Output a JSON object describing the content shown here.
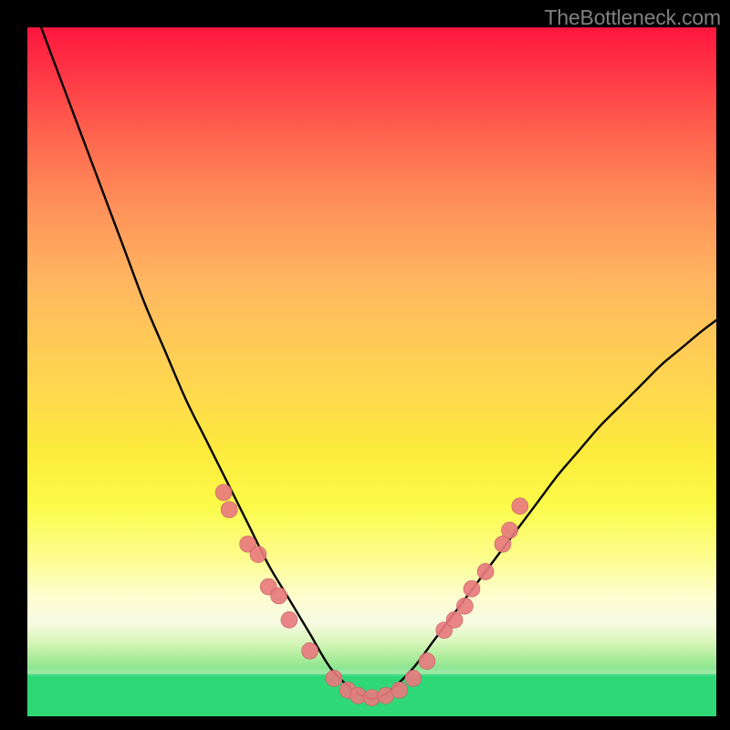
{
  "watermark": "TheBottleneck.com",
  "colors": {
    "background": "#000000",
    "curve": "#000000",
    "marker_fill": "#e77b7e",
    "marker_stroke": "#c65f63",
    "green": "#2fd876"
  },
  "chart_data": {
    "type": "line",
    "title": "",
    "xlabel": "",
    "ylabel": "",
    "xlim": [
      0,
      100
    ],
    "ylim": [
      0,
      100
    ],
    "series": [
      {
        "name": "bottleneck-curve",
        "x": [
          2,
          5,
          8,
          11,
          14,
          17,
          20,
          23,
          26,
          29,
          32,
          35,
          38,
          41,
          44,
          47,
          48.5,
          50,
          51.5,
          53,
          56,
          59,
          62,
          65,
          68,
          71,
          74,
          77,
          80,
          83,
          86,
          89,
          92,
          95,
          98,
          100
        ],
        "y": [
          100,
          92,
          84,
          76,
          68,
          60,
          53,
          46,
          40,
          34,
          28,
          22,
          17,
          12,
          7,
          4,
          3,
          2.5,
          3,
          4,
          7,
          11,
          15,
          19,
          23,
          27,
          31,
          35,
          38.5,
          42,
          45,
          48,
          51,
          53.5,
          56,
          57.5
        ]
      }
    ],
    "markers": [
      {
        "name": "left-cluster-top-a",
        "x": 28.5,
        "y": 32.5
      },
      {
        "name": "left-cluster-top-b",
        "x": 29.3,
        "y": 30.0
      },
      {
        "name": "left-cluster-mid-a",
        "x": 32.0,
        "y": 25.0
      },
      {
        "name": "left-cluster-mid-b",
        "x": 33.5,
        "y": 23.5
      },
      {
        "name": "left-cluster-mid-c",
        "x": 35.0,
        "y": 18.8
      },
      {
        "name": "left-cluster-low-a",
        "x": 36.5,
        "y": 17.5
      },
      {
        "name": "left-cluster-low-b",
        "x": 38.0,
        "y": 14.0
      },
      {
        "name": "left-near-bottom",
        "x": 41.0,
        "y": 9.5
      },
      {
        "name": "bottom-left-a",
        "x": 44.5,
        "y": 5.5
      },
      {
        "name": "bottom-left-b",
        "x": 46.5,
        "y": 3.8
      },
      {
        "name": "bottom-min-a",
        "x": 48.0,
        "y": 3.0
      },
      {
        "name": "bottom-min-b",
        "x": 50.0,
        "y": 2.7
      },
      {
        "name": "bottom-min-c",
        "x": 52.0,
        "y": 3.0
      },
      {
        "name": "bottom-right-a",
        "x": 54.0,
        "y": 3.8
      },
      {
        "name": "bottom-right-b",
        "x": 56.0,
        "y": 5.5
      },
      {
        "name": "right-near-bottom",
        "x": 58.0,
        "y": 8.0
      },
      {
        "name": "right-cluster-low-a",
        "x": 60.5,
        "y": 12.5
      },
      {
        "name": "right-cluster-low-b",
        "x": 62.0,
        "y": 14.0
      },
      {
        "name": "right-cluster-mid-a",
        "x": 63.5,
        "y": 16.0
      },
      {
        "name": "right-cluster-mid-b",
        "x": 64.5,
        "y": 18.5
      },
      {
        "name": "right-cluster-mid-c",
        "x": 66.5,
        "y": 21.0
      },
      {
        "name": "right-cluster-top-a",
        "x": 69.0,
        "y": 25.0
      },
      {
        "name": "right-cluster-top-b",
        "x": 70.0,
        "y": 27.0
      },
      {
        "name": "right-cluster-top-c",
        "x": 71.5,
        "y": 30.5
      }
    ],
    "marker_radius": 9
  }
}
